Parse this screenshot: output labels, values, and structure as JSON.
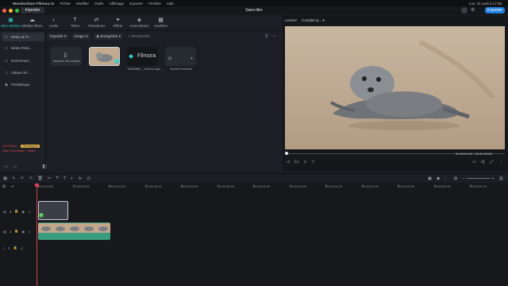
{
  "menubar": {
    "app": "Wondershare Filmora 12",
    "items": [
      "Fichier",
      "Modifier",
      "Outils",
      "Affichage",
      "Exporter",
      "Fenêtre",
      "Aide"
    ],
    "clock": "Lun. 21 août à  17:38"
  },
  "titlebar": {
    "import_label": "Importer",
    "title": "Sans-titre",
    "export_label": "Exporter"
  },
  "media_tabs": [
    {
      "label": "Mes Médias",
      "icon": "folder-media-icon",
      "active": true
    },
    {
      "label": "Médias libres",
      "icon": "cloud-media-icon",
      "active": false
    },
    {
      "label": "Audio",
      "icon": "music-note-icon",
      "active": false
    },
    {
      "label": "Titres",
      "icon": "text-t-icon",
      "active": false
    },
    {
      "label": "Transitions",
      "icon": "transition-icon",
      "active": false
    },
    {
      "label": "Effets",
      "icon": "effects-star-icon",
      "active": false
    },
    {
      "label": "Autocollants",
      "icon": "sticker-icon",
      "active": false
    },
    {
      "label": "modèles",
      "icon": "template-icon",
      "active": false
    }
  ],
  "sidebar": {
    "items": [
      {
        "label": "Média de Pr...",
        "icon": "folder-icon"
      },
      {
        "label": "Média Parta...",
        "icon": "folder-icon"
      },
      {
        "label": "Environnem...",
        "icon": "folder-icon"
      },
      {
        "label": "Calque de r...",
        "icon": "folder-icon"
      },
      {
        "label": "Photothèque",
        "icon": "photo-icon"
      }
    ],
    "badge_left": "4GG-Filmc",
    "badge_right": "Développer",
    "expiry": "Date d'expiration : Statut"
  },
  "media_toolbar": {
    "import_label": "Importer",
    "ai_image_label": "Image IA",
    "record_label": "Enregistrer",
    "search_placeholder": "Rechercher"
  },
  "media_items": [
    {
      "label": "Importer des médias",
      "kind": "import"
    },
    {
      "label": "",
      "kind": "video-seal"
    },
    {
      "label": "16928880..._filmora logo",
      "kind": "logo"
    },
    {
      "label": "Synthé Ncosso2",
      "kind": "synth"
    }
  ],
  "preview": {
    "tab_player": "Lecteur",
    "quality": "Complet Q...",
    "time_current": "00:00:00:00",
    "time_total": "00:00:00:05",
    "progress": 0.0
  },
  "timeline": {
    "ticks": [
      "00:00:00:00",
      "00:00:00:05",
      "00:00:00:10",
      "00:00:00:15",
      "00:00:00:20",
      "00:00:00:25",
      "00:00:01:00",
      "00:00:01:05",
      "00:00:01:10",
      "00:00:01:15",
      "00:00:02:00",
      "00:00:02:05",
      "00:00:02:10"
    ],
    "tracks": [
      {
        "label": "2",
        "type": "video"
      },
      {
        "label": "1",
        "type": "video"
      },
      {
        "label": "1",
        "type": "audio"
      }
    ]
  },
  "colors": {
    "accent": "#30c6c0",
    "export_blue": "#1e7fe0",
    "clip_green": "#3a9c7e",
    "playhead": "#d8404a"
  }
}
